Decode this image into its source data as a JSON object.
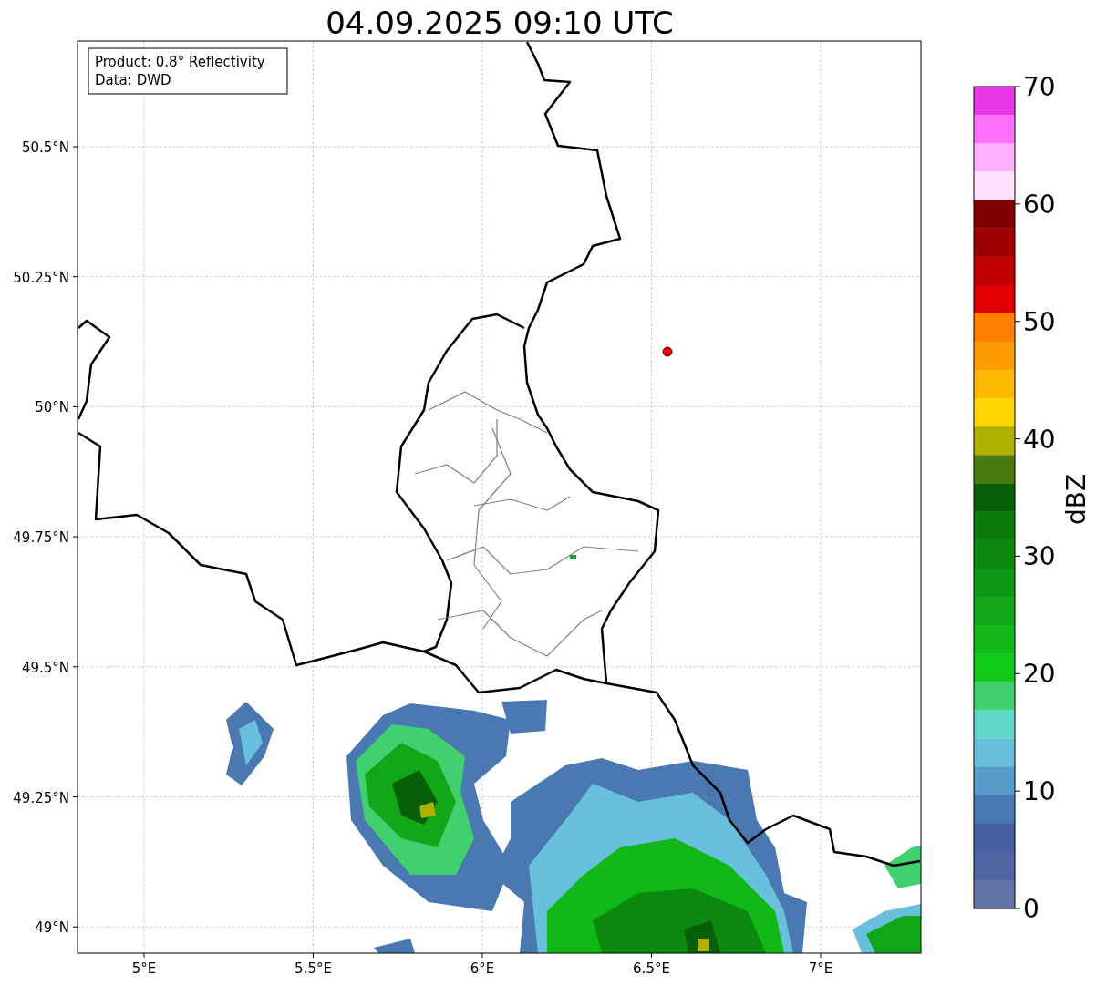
{
  "title": "04.09.2025 09:10 UTC",
  "info_box": {
    "lines": [
      "Product: 0.8° Reflectivity",
      "Data: DWD"
    ]
  },
  "y_ticks": [
    "50.5°N",
    "50.25°N",
    "50°N",
    "49.75°N",
    "49.5°N",
    "49.25°N",
    "49°N"
  ],
  "x_ticks": [
    "5°E",
    "5.5°E",
    "6°E",
    "6.5°E",
    "7°E"
  ],
  "colorbar": {
    "label": "dBZ",
    "ticks": [
      "70",
      "60",
      "50",
      "40",
      "30",
      "20",
      "10",
      "0"
    ],
    "bands": [
      {
        "color": "#e838e8"
      },
      {
        "color": "#ff70ff"
      },
      {
        "color": "#ffb0ff"
      },
      {
        "color": "#ffe0ff"
      },
      {
        "color": "#800000"
      },
      {
        "color": "#a00000"
      },
      {
        "color": "#c00000"
      },
      {
        "color": "#e00000"
      },
      {
        "color": "#ff8000"
      },
      {
        "color": "#ff9c00"
      },
      {
        "color": "#ffb800"
      },
      {
        "color": "#ffd700"
      },
      {
        "color": "#b0b000"
      },
      {
        "color": "#4a7a10"
      },
      {
        "color": "#086008"
      },
      {
        "color": "#0a7a0c"
      },
      {
        "color": "#0c8a10"
      },
      {
        "color": "#0e9818"
      },
      {
        "color": "#10a818"
      },
      {
        "color": "#10b818"
      },
      {
        "color": "#10c818"
      },
      {
        "color": "#40d070"
      },
      {
        "color": "#60d8c8"
      },
      {
        "color": "#68c0dc"
      },
      {
        "color": "#5a9ac8"
      },
      {
        "color": "#4a78b0"
      },
      {
        "color": "#4560a0"
      },
      {
        "color": "#5064a0"
      },
      {
        "color": "#6574a8"
      }
    ]
  }
}
